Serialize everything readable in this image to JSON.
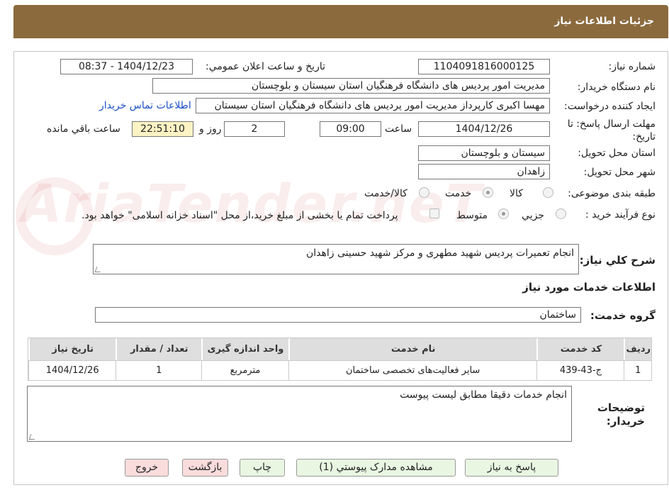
{
  "header": {
    "title": "جزئیات اطلاعات نیاز"
  },
  "watermark": {
    "text": "AriaTender.neT"
  },
  "form": {
    "need_number_label": "شماره نیاز:",
    "need_number_value": "1104091816000125",
    "announce_label": "تاریخ و ساعت اعلان عمومي:",
    "announce_value": "1404/12/23 - 08:37",
    "buyer_org_label": "نام دستگاه خریدار:",
    "buyer_org_value": "مدیریت امور پردیس های دانشگاه فرهنگیان استان سیستان و بلوچستان",
    "requester_label": "ایجاد کننده درخواست:",
    "requester_value": "مهسا اکبری کارپرداز مدیریت امور پردیس های دانشگاه فرهنگیان استان سیستان",
    "contact_link": "اطلاعات تماس خریدار",
    "deadline_label_1": "مهلت ارسال پاسخ: تا",
    "deadline_label_2": "تاریخ:",
    "deadline_date": "1404/12/26",
    "time_label": "ساعت",
    "deadline_time": "09:00",
    "days_value": "2",
    "days_label": "روز و",
    "remaining_time": "22:51:10",
    "remaining_label": "ساعت باقي مانده",
    "province_label": "استان محل تحویل:",
    "province_value": "سیستان و بلوچستان",
    "city_label": "شهر محل تحویل:",
    "city_value": "زاهدان",
    "category_label": "طبقه بندی موضوعی:",
    "category_options": [
      "کالا",
      "خدمت",
      "کالا/خدمت"
    ],
    "category_selected": "خدمت",
    "process_label": "نوع فرآیند خرید :",
    "process_options": [
      "جزيي",
      "متوسط"
    ],
    "process_selected": "متوسط",
    "payment_note": "پرداخت تمام یا بخشی از مبلغ خرید،از محل \"اسناد خزانه اسلامی\" خواهد بود."
  },
  "summary": {
    "label": "شرح کلي نیاز:",
    "value": "انجام تعمیرات پردیس شهید مطهری و مرکز شهید حسینی زاهدان"
  },
  "services": {
    "section_title": "اطلاعات خدمات مورد نیاز",
    "group_label": "گروه خدمت:",
    "group_value": "ساختمان",
    "columns": [
      "ردیف",
      "کد خدمت",
      "نام خدمت",
      "واحد اندازه گیری",
      "تعداد / مقدار",
      "تاریخ نیاز"
    ],
    "rows": [
      [
        "1",
        "ج-43-439",
        "سایر فعالیت‌های تخصصی ساختمان",
        "مترمربع",
        "1",
        "1404/12/26"
      ]
    ]
  },
  "notes": {
    "label_1": "توضیحات",
    "label_2": "خریدار:",
    "value": "انجام خدمات دقیقا مطابق لیست پیوست"
  },
  "buttons": {
    "reply": "پاسخ به نیاز",
    "attachments": "مشاهده مدارک پیوستي (1)",
    "print": "چاپ",
    "back": "بازگشت",
    "exit": "خروج"
  }
}
